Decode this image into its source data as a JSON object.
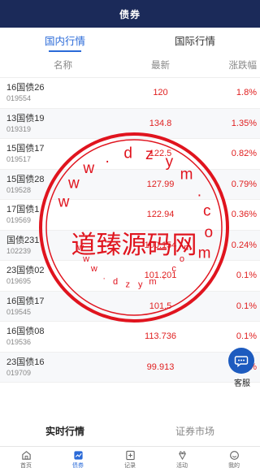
{
  "header": {
    "title": "债券"
  },
  "tabs": [
    {
      "label": "国内行情",
      "active": true
    },
    {
      "label": "国际行情",
      "active": false
    }
  ],
  "columns": {
    "name": "名称",
    "latest": "最新",
    "change": "涨跌幅"
  },
  "bonds": [
    {
      "name": "16国债26",
      "code": "019554",
      "latest": "120",
      "change": "1.8%"
    },
    {
      "name": "13国债19",
      "code": "019319",
      "latest": "134.8",
      "change": "1.35%"
    },
    {
      "name": "15国债17",
      "code": "019517",
      "latest": "122.5",
      "change": "0.82%"
    },
    {
      "name": "15国债28",
      "code": "019528",
      "latest": "127.99",
      "change": "0.79%"
    },
    {
      "name": "17国债1",
      "code": "019569",
      "latest": "122.94",
      "change": "0.36%"
    },
    {
      "name": "国债231",
      "code": "102239",
      "latest": "100.154",
      "change": "0.24%"
    },
    {
      "name": "23国债02",
      "code": "019695",
      "latest": "101.201",
      "change": "0.1%"
    },
    {
      "name": "16国债17",
      "code": "019545",
      "latest": "101.5",
      "change": "0.1%"
    },
    {
      "name": "16国债08",
      "code": "019536",
      "latest": "113.736",
      "change": "0.1%"
    },
    {
      "name": "23国债16",
      "code": "019709",
      "latest": "99.913",
      "change": "0.04%"
    }
  ],
  "subtabs": [
    {
      "label": "实时行情",
      "active": true
    },
    {
      "label": "证券市场",
      "active": false
    }
  ],
  "nav": [
    {
      "label": "首页",
      "icon": "home-icon"
    },
    {
      "label": "债券",
      "icon": "bond-chart-icon",
      "active": true
    },
    {
      "label": "记录",
      "icon": "record-icon"
    },
    {
      "label": "活动",
      "icon": "gift-icon"
    },
    {
      "label": "我的",
      "icon": "profile-icon"
    }
  ],
  "service": {
    "label": "客服",
    "icon": "chat-icon"
  },
  "watermark": {
    "main_text": "道臻源码网",
    "url_text": "www.dzym.com"
  },
  "colors": {
    "header_bg": "#1b2a59",
    "accent": "#2a6ad8",
    "up": "#e02020",
    "watermark": "#e0141e"
  }
}
